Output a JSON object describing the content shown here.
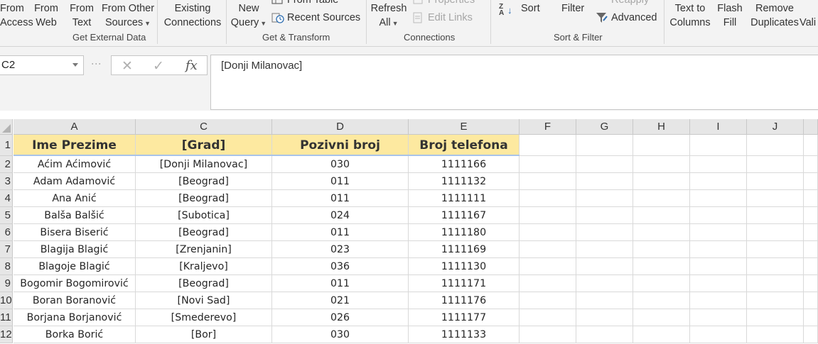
{
  "ribbon": {
    "get_external": {
      "from_access": [
        "From",
        "Access"
      ],
      "from_web": [
        "From",
        "Web"
      ],
      "from_text": [
        "From",
        "Text"
      ],
      "from_other": [
        "From Other",
        "Sources"
      ],
      "label": "Get External Data"
    },
    "existing_connections": [
      "Existing",
      "Connections"
    ],
    "get_transform": {
      "new_query": [
        "New",
        "Query"
      ],
      "from_table": "From Table",
      "recent_sources": "Recent Sources",
      "label": "Get & Transform"
    },
    "connections": {
      "refresh_all": [
        "Refresh",
        "All"
      ],
      "properties": "Properties",
      "edit_links": "Edit Links",
      "label": "Connections"
    },
    "sort_filter": {
      "sort": "Sort",
      "filter": "Filter",
      "reapply": "Reapply",
      "advanced": "Advanced",
      "label": "Sort & Filter"
    },
    "data_tools": {
      "text_to_columns": [
        "Text to",
        "Columns"
      ],
      "flash_fill": [
        "Flash",
        "Fill"
      ],
      "remove_duplicates": [
        "Remove",
        "Duplicates"
      ],
      "data_validation": "Vali"
    }
  },
  "formula_bar": {
    "name_box": "C2",
    "cancel_symbol": "✕",
    "enter_symbol": "✓",
    "fx_symbol": "fx",
    "value": "[Donji Milanovac]"
  },
  "columns": [
    "A",
    "C",
    "D",
    "E",
    "F",
    "G",
    "H",
    "I",
    "J"
  ],
  "row_numbers": [
    "1",
    "2",
    "3",
    "4",
    "5",
    "6",
    "7",
    "8",
    "9",
    "10",
    "11",
    "12"
  ],
  "table": {
    "headers": [
      "Ime Prezime",
      "[Grad]",
      "Pozivni broj",
      "Broj telefona"
    ],
    "rows": [
      [
        "Aćim Aćimović",
        "[Donji Milanovac]",
        "030",
        "1111166"
      ],
      [
        "Adam Adamović",
        "[Beograd]",
        "011",
        "1111132"
      ],
      [
        "Ana Anić",
        "[Beograd]",
        "011",
        "1111111"
      ],
      [
        "Balša Balšić",
        "[Subotica]",
        "024",
        "1111167"
      ],
      [
        "Bisera Biserić",
        "[Beograd]",
        "011",
        "1111180"
      ],
      [
        "Blagija Blagić",
        "[Zrenjanin]",
        "023",
        "1111169"
      ],
      [
        "Blagoje Blagić",
        "[Kraljevo]",
        "036",
        "1111130"
      ],
      [
        "Bogomir Bogomirović",
        "[Beograd]",
        "011",
        "1111171"
      ],
      [
        "Boran Boranović",
        "[Novi Sad]",
        "021",
        "1111176"
      ],
      [
        "Borjana Borjanović",
        "[Smederevo]",
        "026",
        "1111177"
      ],
      [
        "Borka Borić",
        "[Bor]",
        "030",
        "1111133"
      ]
    ]
  },
  "colors": {
    "header_fill": "#fde9a0",
    "ribbon_bg": "#f3f3f3",
    "grid_header_bg": "#e6e6e6"
  },
  "icons": [
    "dropdown-caret-icon",
    "table-icon",
    "clock-icon",
    "sort-az-icon",
    "funnel-icon",
    "select-all-icon"
  ]
}
